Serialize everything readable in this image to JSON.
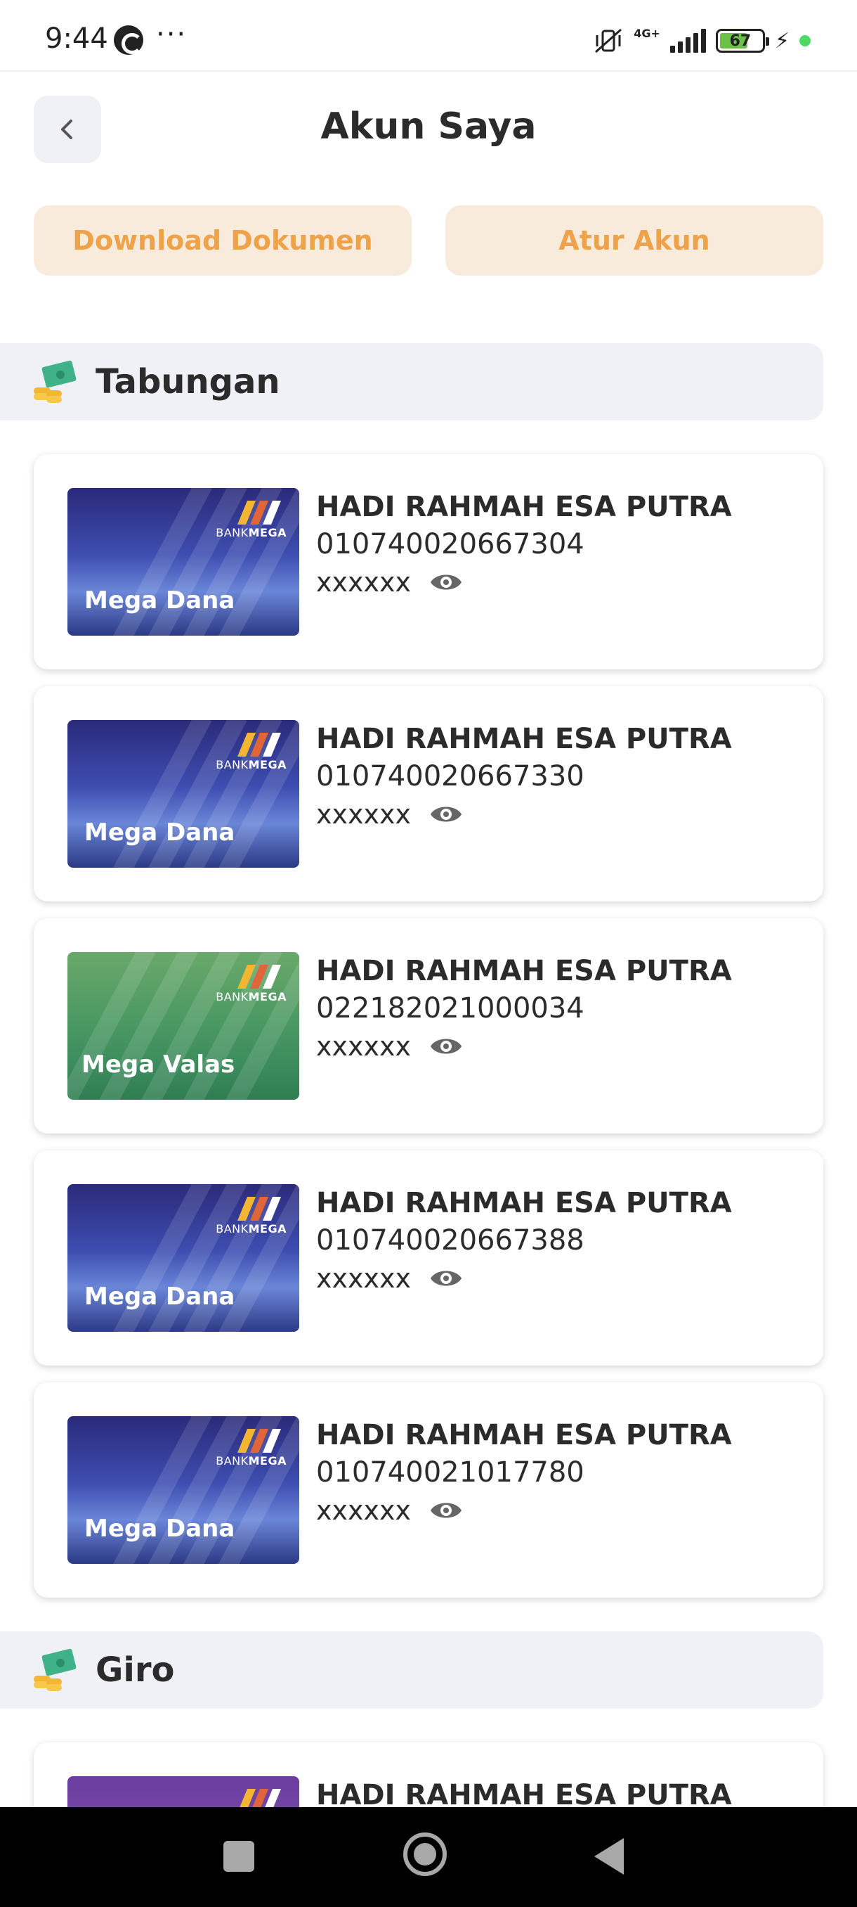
{
  "status_bar": {
    "time": "9:44",
    "more": "···",
    "network": "4G+",
    "battery": "67",
    "battery_level": 0.67
  },
  "header": {
    "title": "Akun Saya",
    "back_icon": "chevron-left-icon"
  },
  "actions": {
    "download_label": "Download Dokumen",
    "settings_label": "Atur Akun"
  },
  "sections": {
    "savings_title": "Tabungan",
    "giro_title": "Giro"
  },
  "accounts": [
    {
      "product": "Mega Dana",
      "name": "HADI RAHMAH ESA PUTRA",
      "number": "010740020667304",
      "balance": "xxxxxx"
    },
    {
      "product": "Mega Dana",
      "name": "HADI RAHMAH ESA PUTRA",
      "number": "010740020667330",
      "balance": "xxxxxx"
    },
    {
      "product": "Mega Valas",
      "name": "HADI RAHMAH ESA PUTRA",
      "number": "022182021000034",
      "balance": "xxxxxx"
    },
    {
      "product": "Mega Dana",
      "name": "HADI RAHMAH ESA PUTRA",
      "number": "010740020667388",
      "balance": "xxxxxx"
    },
    {
      "product": "Mega Dana",
      "name": "HADI RAHMAH ESA PUTRA",
      "number": "010740021017780",
      "balance": "xxxxxx"
    }
  ],
  "giro_accounts": [
    {
      "name": "HADI RAHMAH ESA PUTRA"
    }
  ],
  "card_logo": {
    "bank_prefix": "BANK",
    "bank_name": "MEGA"
  },
  "colors": {
    "accent_orange": "#eea34a",
    "button_bg": "#f9ebdc",
    "section_bg": "#f0f1f6"
  }
}
